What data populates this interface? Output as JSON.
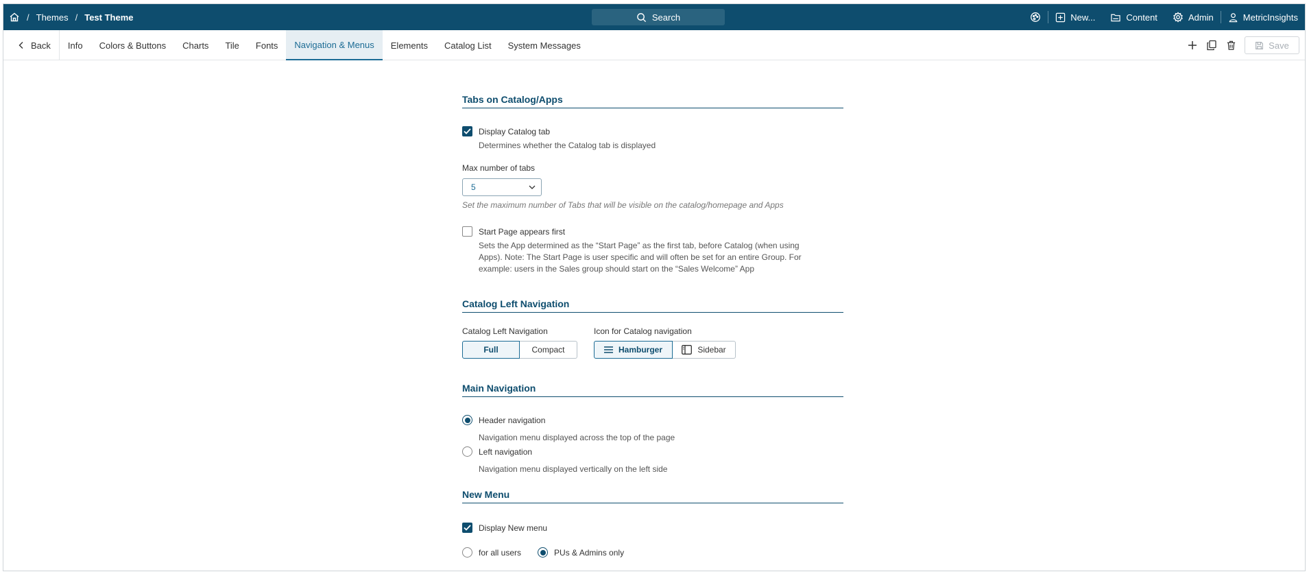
{
  "header": {
    "breadcrumbs": [
      "Themes",
      "Test Theme"
    ],
    "breadcrumb_sep": "/",
    "search_label": "Search",
    "new_label": "New...",
    "content_label": "Content",
    "admin_label": "Admin",
    "user_label": "MetricInsights"
  },
  "tabs": {
    "back_label": "Back",
    "items": [
      "Info",
      "Colors & Buttons",
      "Charts",
      "Tile",
      "Fonts",
      "Navigation & Menus",
      "Elements",
      "Catalog List",
      "System Messages"
    ],
    "active": "Navigation & Menus",
    "save_label": "Save"
  },
  "sections": {
    "tabs_catalog": {
      "title": "Tabs on Catalog/Apps",
      "display_catalog_tab": {
        "label": "Display Catalog tab",
        "checked": true,
        "desc": "Determines whether the Catalog tab is displayed"
      },
      "max_tabs": {
        "label": "Max number of tabs",
        "value": "5",
        "help": "Set the maximum number of Tabs that will be visible on the catalog/homepage and Apps"
      },
      "start_page_first": {
        "label": "Start Page appears first",
        "checked": false,
        "desc_lines": [
          "Sets the App determined as the “Start Page” as the first tab, before Catalog (when using",
          "Apps). Note: The Start Page is user specific and will often be set for an entire Group. For",
          "example: users in the Sales group should start on the “Sales Welcome” App"
        ]
      }
    },
    "catalog_left_nav": {
      "title": "Catalog Left Navigation",
      "nav_label": "Catalog Left Navigation",
      "nav_options": [
        "Full",
        "Compact"
      ],
      "nav_selected": "Full",
      "icon_label": "Icon for Catalog navigation",
      "icon_options": [
        "Hamburger",
        "Sidebar"
      ],
      "icon_selected": "Hamburger"
    },
    "main_nav": {
      "title": "Main Navigation",
      "options": [
        {
          "label": "Header navigation",
          "desc": "Navigation menu displayed across the top of the page",
          "selected": true
        },
        {
          "label": "Left navigation",
          "desc": "Navigation menu displayed vertically on the left side",
          "selected": false
        }
      ]
    },
    "new_menu": {
      "title": "New Menu",
      "display_new_menu": {
        "label": "Display New menu",
        "checked": true
      },
      "audience_options": [
        "for all users",
        "PUs & Admins only"
      ],
      "audience_selected": "PUs & Admins only"
    }
  },
  "colors": {
    "header_bg": "#0e4d6e",
    "accent": "#1b6b94",
    "active_tab_bg": "#e6eef3"
  }
}
